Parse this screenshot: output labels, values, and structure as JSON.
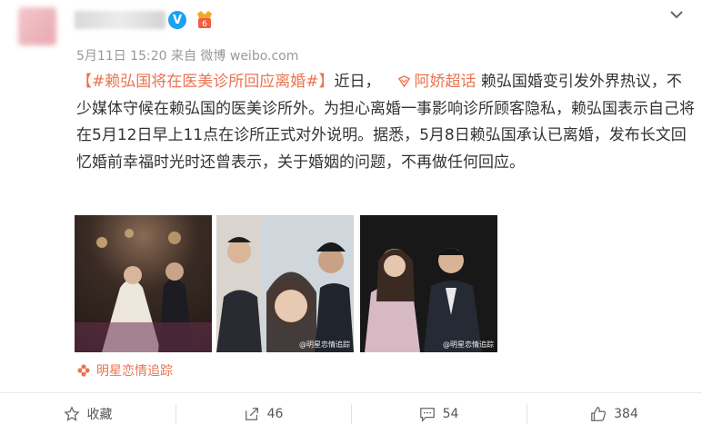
{
  "post": {
    "meta": "5月11日 15:20 来自 微博 weibo.com",
    "hashtag": "【#赖弘国将在医美诊所回应离婚#】",
    "text_a": "近日，",
    "topic": "阿娇超话",
    "text_b": " 赖弘国婚变引发外界热议，不少媒体守候在赖弘国的医美诊所外。为担心离婚一事影响诊所顾客隐私，赖弘国表示自己将在5月12日早上11点在诊所正式对外说明。据悉，5月8日赖弘国承认已离婚，发布长文回忆婚前幸福时光时还曾表示，关于婚姻的问题，不再做任何回应。",
    "source": "明星恋情追踪",
    "image_watermark_2": "@明星恋情追踪",
    "image_watermark_3": "@明星恋情追踪"
  },
  "toolbar": {
    "favorite_label": "收藏",
    "repost_count": "46",
    "comment_count": "54",
    "like_count": "384"
  },
  "colors": {
    "accent": "#eb7350",
    "verified": "#1da1f2"
  },
  "icons": [
    "verified-icon",
    "medal-icon",
    "chevron-down-icon",
    "topic-icon",
    "flower-icon",
    "star-icon",
    "repost-icon",
    "comment-icon",
    "like-icon"
  ]
}
